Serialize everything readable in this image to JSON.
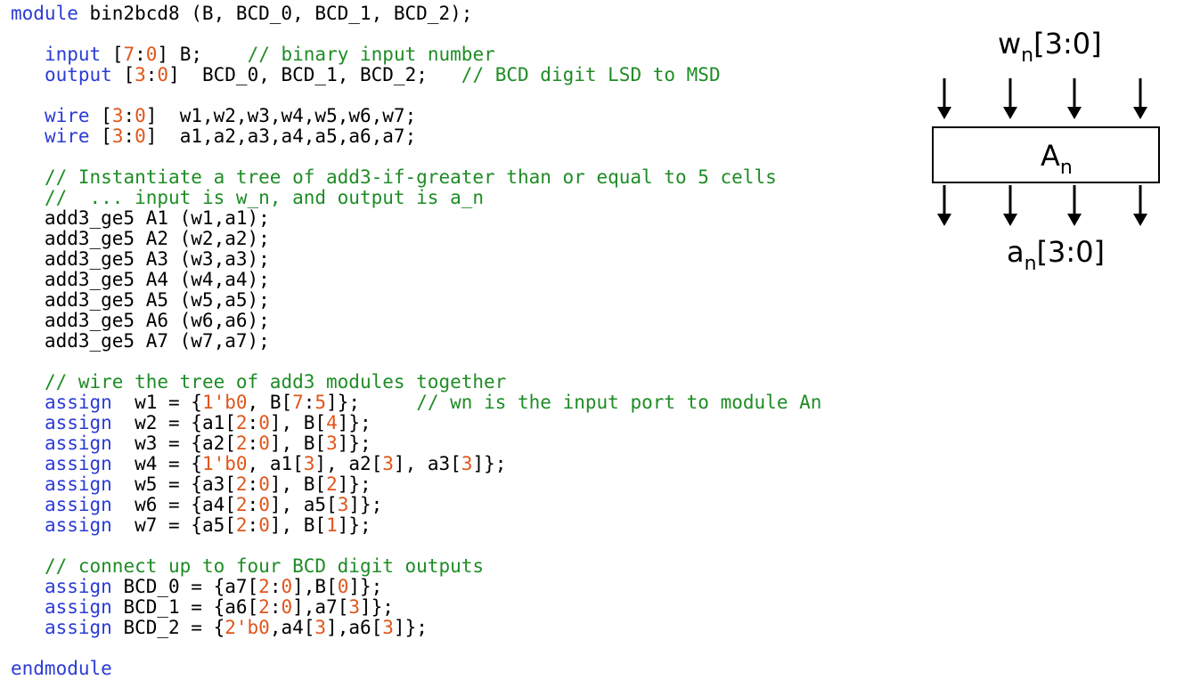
{
  "code_lines": [
    [
      [
        "kw",
        "module"
      ],
      [
        "tx",
        " bin2bcd8 (B, BCD_0, BCD_1, BCD_2);"
      ]
    ],
    [],
    [
      [
        "tx",
        "   "
      ],
      [
        "kw",
        "input"
      ],
      [
        "tx",
        " ["
      ],
      [
        "nm",
        "7"
      ],
      [
        "tx",
        ":"
      ],
      [
        "nm",
        "0"
      ],
      [
        "tx",
        "] B;    "
      ],
      [
        "cm",
        "// binary input number"
      ]
    ],
    [
      [
        "tx",
        "   "
      ],
      [
        "kw",
        "output"
      ],
      [
        "tx",
        " ["
      ],
      [
        "nm",
        "3"
      ],
      [
        "tx",
        ":"
      ],
      [
        "nm",
        "0"
      ],
      [
        "tx",
        "]  BCD_0, BCD_1, BCD_2;   "
      ],
      [
        "cm",
        "// BCD digit LSD to MSD"
      ]
    ],
    [],
    [
      [
        "tx",
        "   "
      ],
      [
        "kw",
        "wire"
      ],
      [
        "tx",
        " ["
      ],
      [
        "nm",
        "3"
      ],
      [
        "tx",
        ":"
      ],
      [
        "nm",
        "0"
      ],
      [
        "tx",
        "]  w1,w2,w3,w4,w5,w6,w7;"
      ]
    ],
    [
      [
        "tx",
        "   "
      ],
      [
        "kw",
        "wire"
      ],
      [
        "tx",
        " ["
      ],
      [
        "nm",
        "3"
      ],
      [
        "tx",
        ":"
      ],
      [
        "nm",
        "0"
      ],
      [
        "tx",
        "]  a1,a2,a3,a4,a5,a6,a7;"
      ]
    ],
    [],
    [
      [
        "tx",
        "   "
      ],
      [
        "cm",
        "// Instantiate a tree of add3-if-greater than or equal to 5 cells"
      ]
    ],
    [
      [
        "tx",
        "   "
      ],
      [
        "cm",
        "//  ... input is w_n, and output is a_n"
      ]
    ],
    [
      [
        "tx",
        "   add3_ge5 A1 (w1,a1);"
      ]
    ],
    [
      [
        "tx",
        "   add3_ge5 A2 (w2,a2);"
      ]
    ],
    [
      [
        "tx",
        "   add3_ge5 A3 (w3,a3);"
      ]
    ],
    [
      [
        "tx",
        "   add3_ge5 A4 (w4,a4);"
      ]
    ],
    [
      [
        "tx",
        "   add3_ge5 A5 (w5,a5);"
      ]
    ],
    [
      [
        "tx",
        "   add3_ge5 A6 (w6,a6);"
      ]
    ],
    [
      [
        "tx",
        "   add3_ge5 A7 (w7,a7);"
      ]
    ],
    [],
    [
      [
        "tx",
        "   "
      ],
      [
        "cm",
        "// wire the tree of add3 modules together"
      ]
    ],
    [
      [
        "tx",
        "   "
      ],
      [
        "kw",
        "assign"
      ],
      [
        "tx",
        "  w1 = {"
      ],
      [
        "nm",
        "1'b0"
      ],
      [
        "tx",
        ", B["
      ],
      [
        "nm",
        "7"
      ],
      [
        "tx",
        ":"
      ],
      [
        "nm",
        "5"
      ],
      [
        "tx",
        "]};     "
      ],
      [
        "cm",
        "// wn is the input port to module An"
      ]
    ],
    [
      [
        "tx",
        "   "
      ],
      [
        "kw",
        "assign"
      ],
      [
        "tx",
        "  w2 = {a1["
      ],
      [
        "nm",
        "2"
      ],
      [
        "tx",
        ":"
      ],
      [
        "nm",
        "0"
      ],
      [
        "tx",
        "], B["
      ],
      [
        "nm",
        "4"
      ],
      [
        "tx",
        "]};"
      ]
    ],
    [
      [
        "tx",
        "   "
      ],
      [
        "kw",
        "assign"
      ],
      [
        "tx",
        "  w3 = {a2["
      ],
      [
        "nm",
        "2"
      ],
      [
        "tx",
        ":"
      ],
      [
        "nm",
        "0"
      ],
      [
        "tx",
        "], B["
      ],
      [
        "nm",
        "3"
      ],
      [
        "tx",
        "]};"
      ]
    ],
    [
      [
        "tx",
        "   "
      ],
      [
        "kw",
        "assign"
      ],
      [
        "tx",
        "  w4 = {"
      ],
      [
        "nm",
        "1'b0"
      ],
      [
        "tx",
        ", a1["
      ],
      [
        "nm",
        "3"
      ],
      [
        "tx",
        "], a2["
      ],
      [
        "nm",
        "3"
      ],
      [
        "tx",
        "], a3["
      ],
      [
        "nm",
        "3"
      ],
      [
        "tx",
        "]};"
      ]
    ],
    [
      [
        "tx",
        "   "
      ],
      [
        "kw",
        "assign"
      ],
      [
        "tx",
        "  w5 = {a3["
      ],
      [
        "nm",
        "2"
      ],
      [
        "tx",
        ":"
      ],
      [
        "nm",
        "0"
      ],
      [
        "tx",
        "], B["
      ],
      [
        "nm",
        "2"
      ],
      [
        "tx",
        "]};"
      ]
    ],
    [
      [
        "tx",
        "   "
      ],
      [
        "kw",
        "assign"
      ],
      [
        "tx",
        "  w6 = {a4["
      ],
      [
        "nm",
        "2"
      ],
      [
        "tx",
        ":"
      ],
      [
        "nm",
        "0"
      ],
      [
        "tx",
        "], a5["
      ],
      [
        "nm",
        "3"
      ],
      [
        "tx",
        "]};"
      ]
    ],
    [
      [
        "tx",
        "   "
      ],
      [
        "kw",
        "assign"
      ],
      [
        "tx",
        "  w7 = {a5["
      ],
      [
        "nm",
        "2"
      ],
      [
        "tx",
        ":"
      ],
      [
        "nm",
        "0"
      ],
      [
        "tx",
        "], B["
      ],
      [
        "nm",
        "1"
      ],
      [
        "tx",
        "]};"
      ]
    ],
    [],
    [
      [
        "tx",
        "   "
      ],
      [
        "cm",
        "// connect up to four BCD digit outputs"
      ]
    ],
    [
      [
        "tx",
        "   "
      ],
      [
        "kw",
        "assign"
      ],
      [
        "tx",
        " BCD_0 = {a7["
      ],
      [
        "nm",
        "2"
      ],
      [
        "tx",
        ":"
      ],
      [
        "nm",
        "0"
      ],
      [
        "tx",
        "],B["
      ],
      [
        "nm",
        "0"
      ],
      [
        "tx",
        "]};"
      ]
    ],
    [
      [
        "tx",
        "   "
      ],
      [
        "kw",
        "assign"
      ],
      [
        "tx",
        " BCD_1 = {a6["
      ],
      [
        "nm",
        "2"
      ],
      [
        "tx",
        ":"
      ],
      [
        "nm",
        "0"
      ],
      [
        "tx",
        "],a7["
      ],
      [
        "nm",
        "3"
      ],
      [
        "tx",
        "]};"
      ]
    ],
    [
      [
        "tx",
        "   "
      ],
      [
        "kw",
        "assign"
      ],
      [
        "tx",
        " BCD_2 = {"
      ],
      [
        "nm",
        "2'b0"
      ],
      [
        "tx",
        ",a4["
      ],
      [
        "nm",
        "3"
      ],
      [
        "tx",
        "],a6["
      ],
      [
        "nm",
        "3"
      ],
      [
        "tx",
        "]};"
      ]
    ],
    [],
    [
      [
        "kw",
        "endmodule"
      ]
    ]
  ],
  "colors": {
    "keyword": "#2b3bd6",
    "number": "#e0561a",
    "comment": "#1e8c25",
    "text": "#000000"
  },
  "diagram": {
    "input_label": {
      "main": "w",
      "sub": "n",
      "rest": "[3:0]"
    },
    "block_label": {
      "main": "A",
      "sub": "n"
    },
    "output_label": {
      "main": "a",
      "sub": "n",
      "rest": "[3:0]"
    },
    "input_arrow_count": 4,
    "output_arrow_count": 4
  }
}
